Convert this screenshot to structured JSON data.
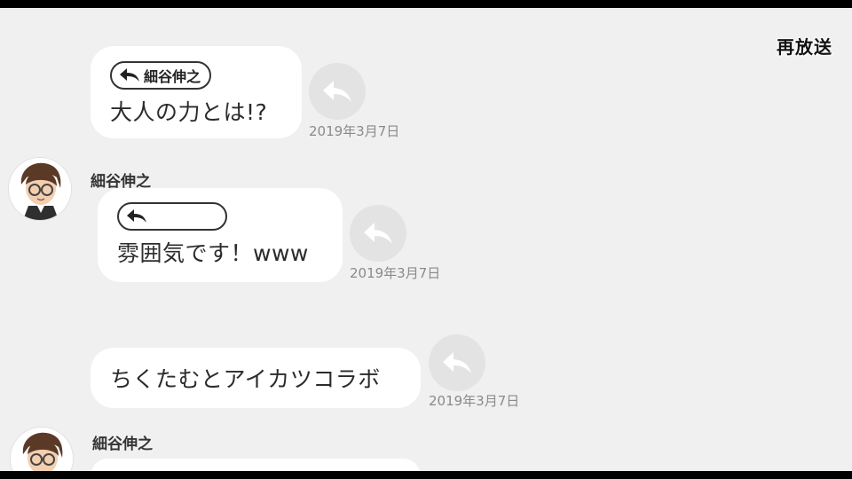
{
  "header": {
    "replay_label": "再放送"
  },
  "messages": [
    {
      "quote": "細谷伸之",
      "text": "大人の力とは!?",
      "timestamp": "2019年3月7日"
    },
    {
      "sender": "細谷伸之",
      "quote": "",
      "text": "雰囲気です！www",
      "timestamp": "2019年3月7日"
    },
    {
      "text": "ちくたむとアイカツコラボ",
      "timestamp": "2019年3月7日"
    },
    {
      "sender": "細谷伸之"
    }
  ],
  "icons": {
    "reply": "reply-arrow-icon",
    "quote": "quote-arrow-icon",
    "avatar": "avatar-illustration"
  },
  "colors": {
    "background": "#f0f0f0",
    "bubble": "#ffffff",
    "reply_button": "#e3e3e3",
    "timestamp": "#8a8a8a"
  }
}
